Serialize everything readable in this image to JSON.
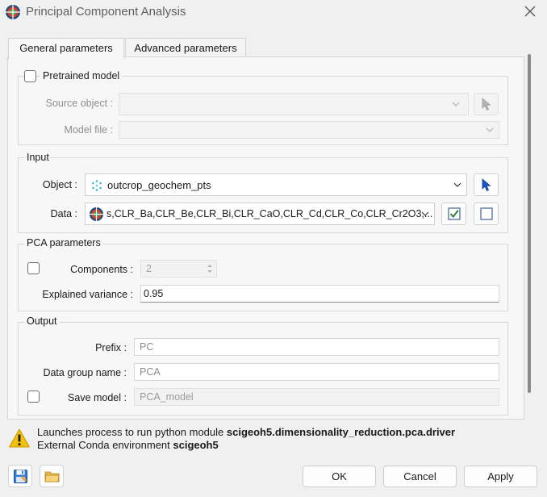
{
  "window": {
    "title": "Principal Component Analysis"
  },
  "tabs": [
    {
      "label": "General parameters",
      "active": true
    },
    {
      "label": "Advanced parameters",
      "active": false
    }
  ],
  "pretrained": {
    "checkbox_label": "Pretrained model",
    "checked": false,
    "source_object_label": "Source object :",
    "source_object_value": "",
    "model_file_label": "Model file :",
    "model_file_value": ""
  },
  "input": {
    "title": "Input",
    "object_label": "Object :",
    "object_value": "outcrop_geochem_pts",
    "data_label": "Data :",
    "data_value": "s,CLR_Ba,CLR_Be,CLR_Bi,CLR_CaO,CLR_Cd,CLR_Co,CLR_Cr2O3,..."
  },
  "pca": {
    "title": "PCA parameters",
    "components_label": "Components :",
    "components_value": "2",
    "components_checked": false,
    "explained_variance_label": "Explained variance :",
    "explained_variance_value": "0.95"
  },
  "output": {
    "title": "Output",
    "prefix_label": "Prefix :",
    "prefix_value": "PC",
    "data_group_label": "Data group name :",
    "data_group_value": "PCA",
    "save_model_label": "Save model :",
    "save_model_value": "PCA_model",
    "save_model_checked": false
  },
  "status": {
    "line1_prefix": "Launches process to run python module ",
    "line1_module": "scigeoh5.dimensionality_reduction.pca.driver",
    "line2_prefix": "External Conda environment ",
    "line2_env": "scigeoh5"
  },
  "buttons": {
    "ok": "OK",
    "cancel": "Cancel",
    "apply": "Apply"
  },
  "colors": {
    "accent": "#1a56c8",
    "warning": "#f2c011",
    "check": "#2e7d32"
  }
}
